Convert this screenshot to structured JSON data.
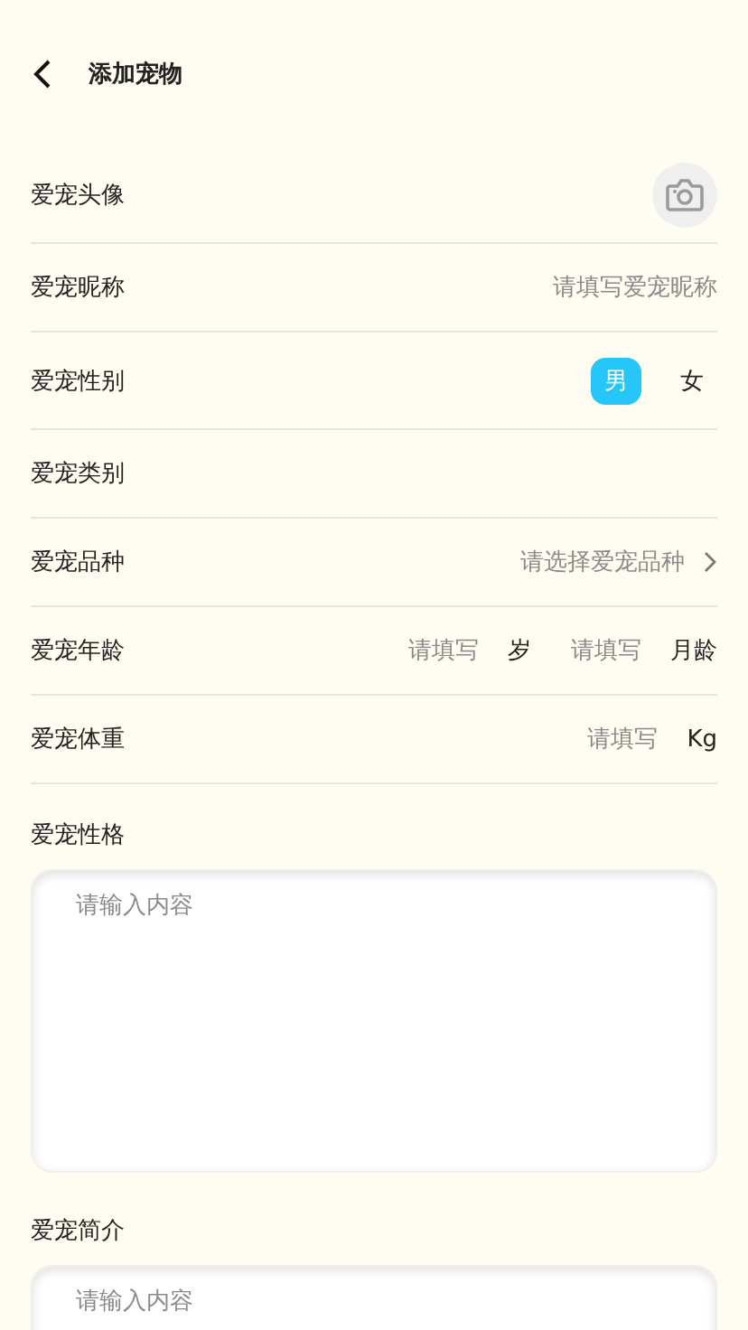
{
  "header": {
    "title": "添加宠物"
  },
  "rows": [
    {
      "kind": "avatar",
      "label": "爱宠头像"
    },
    {
      "kind": "text",
      "label": "爱宠昵称",
      "placeholder": "请填写爱宠昵称"
    },
    {
      "kind": "choice",
      "label": "爱宠性别",
      "options": [
        {
          "label": "男",
          "selected": true
        },
        {
          "label": "女",
          "selected": false
        }
      ]
    },
    {
      "kind": "plain",
      "label": "爱宠类别"
    },
    {
      "kind": "select",
      "label": "爱宠品种",
      "placeholder": "请选择爱宠品种"
    },
    {
      "kind": "units",
      "label": "爱宠年龄",
      "fields": [
        {
          "placeholder": "请填写",
          "unit": "岁"
        },
        {
          "placeholder": "请填写",
          "unit": "月龄"
        }
      ]
    },
    {
      "kind": "units",
      "label": "爱宠体重",
      "fields": [
        {
          "placeholder": "请填写",
          "unit": "Kg"
        }
      ]
    }
  ],
  "areas": [
    {
      "label": "爱宠性格",
      "placeholder": "请输入内容"
    },
    {
      "label": "爱宠简介",
      "placeholder": "请输入内容"
    }
  ]
}
